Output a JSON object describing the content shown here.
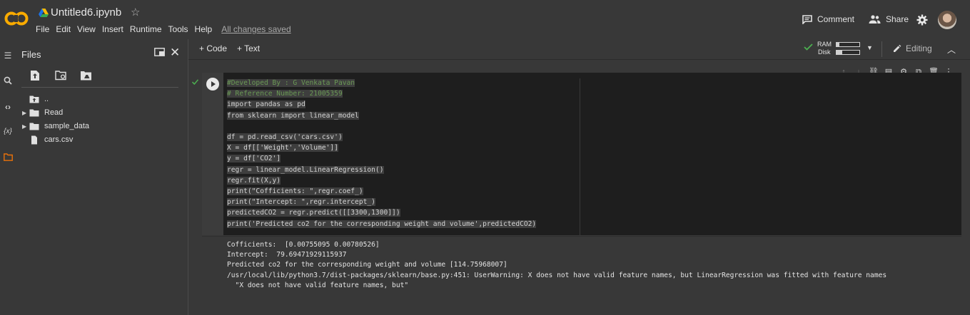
{
  "header": {
    "logo_text": "CO",
    "notebook_title": "Untitled6.ipynb",
    "menu": [
      "File",
      "Edit",
      "View",
      "Insert",
      "Runtime",
      "Tools",
      "Help"
    ],
    "save_status": "All changes saved",
    "comment_label": "Comment",
    "share_label": "Share"
  },
  "sidebar": {
    "title": "Files",
    "tree": [
      {
        "label": "..",
        "kind": "parent"
      },
      {
        "label": "Read",
        "kind": "folder"
      },
      {
        "label": "sample_data",
        "kind": "folder"
      },
      {
        "label": "cars.csv",
        "kind": "file"
      }
    ]
  },
  "toolbar": {
    "add_code_label": "+ Code",
    "add_text_label": "+ Text",
    "ram_label": "RAM",
    "disk_label": "Disk",
    "ram_usage": 0.12,
    "disk_usage": 0.25,
    "editing_label": "Editing"
  },
  "cell": {
    "code_lines": [
      "#Developed By : G Venkata Pavan",
      "# Reference Number: 21005359",
      "import pandas as pd",
      "from sklearn import linear_model",
      "",
      "df = pd.read_csv('cars.csv')",
      "X = df[['Weight','Volume']]",
      "y = df['CO2']",
      "regr = linear_model.LinearRegression()",
      "regr.fit(X,y)",
      "print(\"Cofficients: \",regr.coef_)",
      "print(\"Intercept: \",regr.intercept_)",
      "predictedCO2 = regr.predict([[3300,1300]])",
      "print('Predicted co2 for the corresponding weight and volume',predictedCO2)"
    ],
    "output": "Cofficients:  [0.00755095 0.00780526]\nIntercept:  79.69471929115937\nPredicted co2 for the corresponding weight and volume [114.75968007]\n/usr/local/lib/python3.7/dist-packages/sklearn/base.py:451: UserWarning: X does not have valid feature names, but LinearRegression was fitted with feature names\n  \"X does not have valid feature names, but\""
  },
  "colors": {
    "background": "#383838",
    "code_bg": "#1e1e1e",
    "logo_orange": "#f9ab00",
    "success_green": "#4caf50"
  }
}
